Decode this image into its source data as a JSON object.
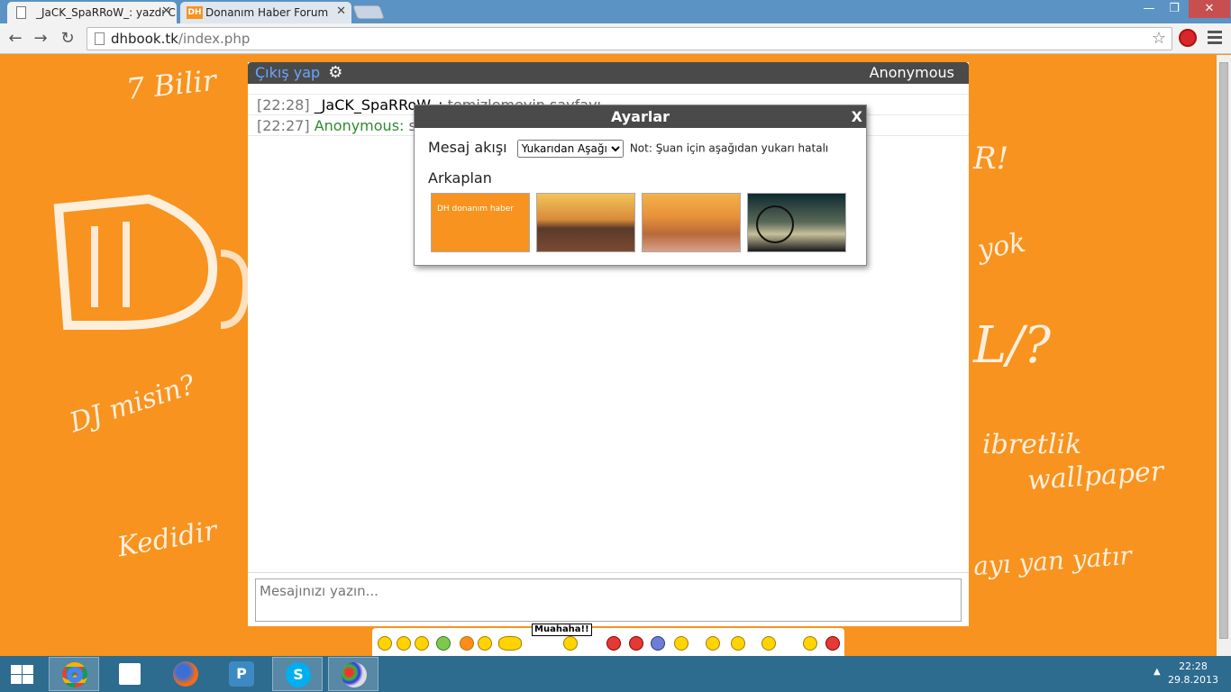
{
  "browser": {
    "tabs": [
      {
        "title": "_JaCK_SpaRRoW_: yazdı Cl",
        "active": true,
        "favicon": "page-icon"
      },
      {
        "title": "Donanım Haber Forum",
        "active": false,
        "favicon": "dh-icon"
      }
    ],
    "close_glyph": "✕",
    "url_host": "dhbook.tk",
    "url_path": "/index.php",
    "window_controls": {
      "minimize": "—",
      "maximize": "❐",
      "close": "✕"
    }
  },
  "background": {
    "doodles": [
      "7 Bilir",
      "DJ misin?",
      "Kedidir",
      "ibretlik",
      "wallpaper",
      "yok",
      "R!",
      "ayı yan yatır"
    ]
  },
  "chat": {
    "header": {
      "logout_label": "Çıkış yap",
      "gear_icon": "⚙",
      "username": "Anonymous"
    },
    "messages": [
      {
        "time": "[22:28]",
        "author": "_JaCK_SpaRRoW_:",
        "text": "temizlemeyin sayfayı"
      },
      {
        "time": "[22:27]",
        "author": "Anonymous:",
        "text": "selam"
      }
    ],
    "compose_placeholder": "Mesajınızı yazın..."
  },
  "settings_modal": {
    "title": "Ayarlar",
    "close_label": "X",
    "flow_label": "Mesaj akışı",
    "flow_selected": "Yukarıdan Aşağı",
    "flow_note": "Not: Şuan için aşağıdan yukarı hatalı",
    "background_label": "Arkaplan",
    "thumbnail_caption": "DH donanım haber"
  },
  "emoji_bar": {
    "muahaha_label": "Muahaha!!"
  },
  "taskbar": {
    "time": "22:28",
    "date": "29.8.2013",
    "tray_arrow": "▲"
  },
  "colors": {
    "page_bg": "#f7931e",
    "header_bg": "#4a4a4a",
    "link_blue": "#6aa6ff",
    "user_green": "#2e8b2e",
    "taskbar_bg": "#2d6b8f",
    "titlebar_bg": "#5a93c4"
  }
}
